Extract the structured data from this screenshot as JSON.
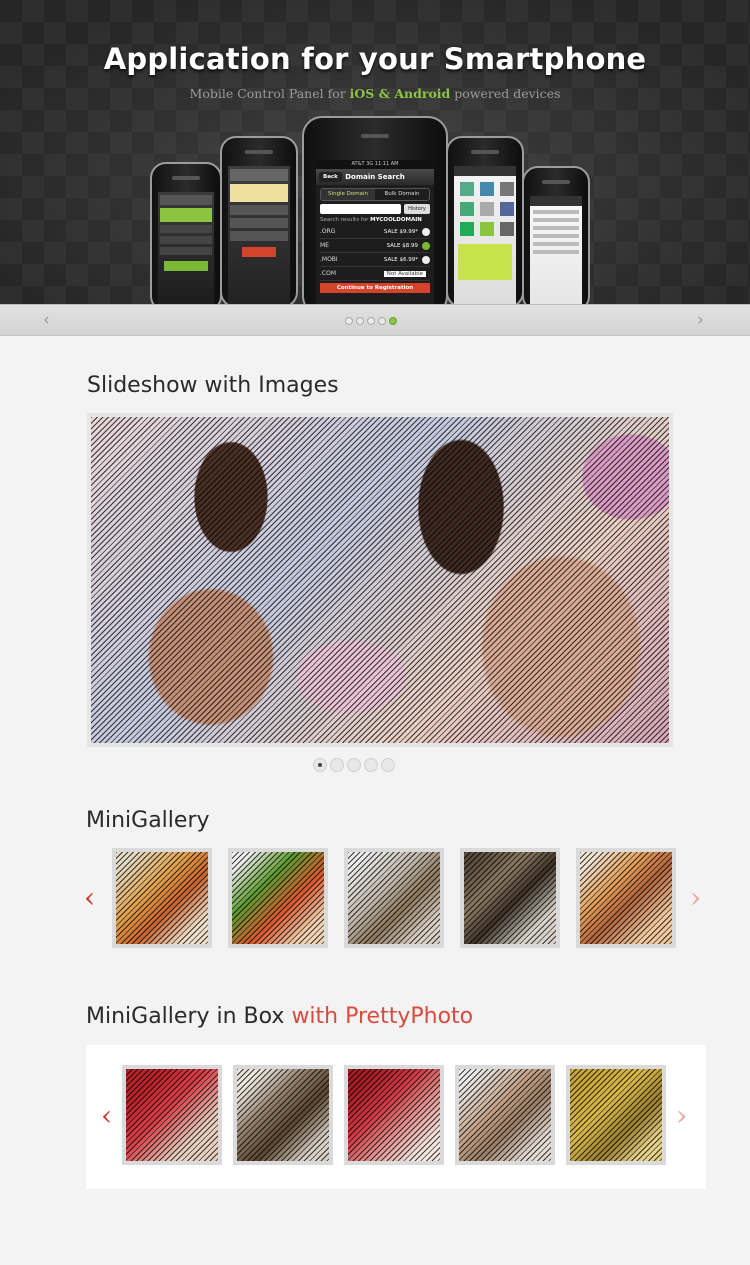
{
  "hero": {
    "title": "Application for your Smartphone",
    "subtitle_pre": "Mobile Control Panel for ",
    "subtitle_hl": "iOS & Android",
    "subtitle_post": " powered devices",
    "phone_screen": {
      "status": "AT&T 3G    11:11 AM",
      "back": "Back",
      "title": "Domain Search",
      "tab_single": "Single Domain",
      "tab_bulk": "Bulk Domain",
      "history": "History",
      "results_label": "Search results for",
      "results_term": "MYCOOLDOMAIN",
      "rows": [
        {
          "tld": ".ORG",
          "price": "SALE $9.99*"
        },
        {
          "tld": "ME",
          "price": "SALE $8.99"
        },
        {
          "tld": ".MOBI",
          "price": "SALE $6.99*"
        },
        {
          "tld": ".COM",
          "price": "Not Available"
        }
      ],
      "continue": "Continue to Registration"
    },
    "slider_dots": 5,
    "active_dot": 5
  },
  "slider_nav": {
    "prev": "‹",
    "next": "›"
  },
  "section1": {
    "title": "Slideshow with Images",
    "dots": 5,
    "active": 1
  },
  "section2": {
    "title": "MiniGallery",
    "prev": "‹",
    "next": "›"
  },
  "section3": {
    "title": "MiniGallery in Box ",
    "title_highlight": "with PrettyPhoto",
    "prev": "‹",
    "next": "›"
  },
  "colors": {
    "accent_green": "#8bc540",
    "accent_red": "#d84b3d",
    "background": "#f3f3f3"
  }
}
